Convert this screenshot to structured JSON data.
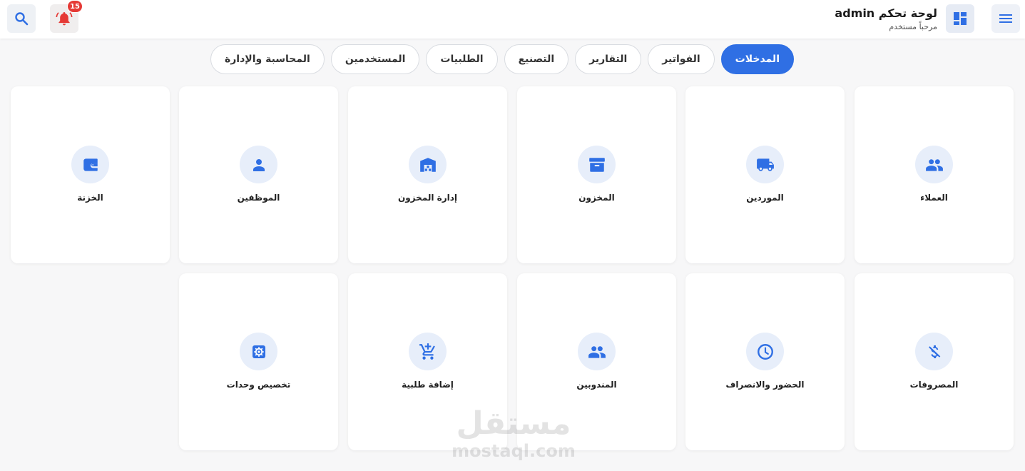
{
  "header": {
    "title": "لوحة تحكم admin",
    "subtitle": "مرحباً مستخدم",
    "notification_count": "15"
  },
  "tabs": [
    {
      "label": "المدخلات",
      "active": true
    },
    {
      "label": "الفواتير",
      "active": false
    },
    {
      "label": "التقارير",
      "active": false
    },
    {
      "label": "التصنيع",
      "active": false
    },
    {
      "label": "الطلبيات",
      "active": false
    },
    {
      "label": "المستخدمين",
      "active": false
    },
    {
      "label": "المحاسبة والإدارة",
      "active": false
    }
  ],
  "cards": [
    {
      "label": "العملاء",
      "icon": "people-icon"
    },
    {
      "label": "الموردين",
      "icon": "truck-icon"
    },
    {
      "label": "المخزون",
      "icon": "archive-box-icon"
    },
    {
      "label": "إدارة المخزون",
      "icon": "warehouse-icon"
    },
    {
      "label": "الموظفين",
      "icon": "person-icon"
    },
    {
      "label": "الخزنة",
      "icon": "wallet-icon"
    },
    {
      "label": "المصروفات",
      "icon": "money-off-icon"
    },
    {
      "label": "الحضور والانصراف",
      "icon": "clock-icon"
    },
    {
      "label": "المندوبين",
      "icon": "people-icon"
    },
    {
      "label": "إضافة طلبية",
      "icon": "add-cart-icon"
    },
    {
      "label": "تخصيص وحدات",
      "icon": "settings-icon"
    }
  ],
  "watermark": {
    "arabic": "مستقل",
    "latin": "mostaql.com"
  },
  "colors": {
    "accent": "#2f6fe4",
    "icon_bg": "#e7eefa",
    "badge": "#e53935",
    "bell": "#e53935"
  }
}
